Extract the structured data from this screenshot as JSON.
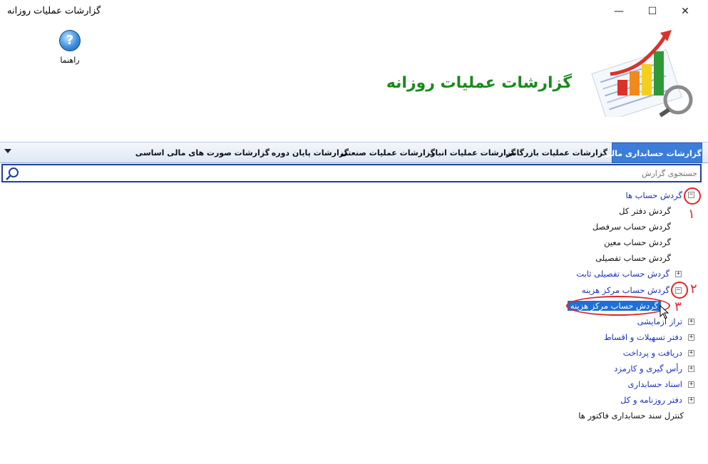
{
  "window": {
    "title": "گزارشات عملیات روزانه",
    "minimize_glyph": "—",
    "maximize_glyph": "☐",
    "close_glyph": "✕"
  },
  "toolbar": {
    "help_glyph": "?",
    "help_label": "راهنما"
  },
  "header": {
    "title": "گزارشات عملیات روزانه"
  },
  "tabs": [
    {
      "label": "گزارشات حسابداری مالی",
      "active": true
    },
    {
      "label": "گزارشات عملیات بازرگانی",
      "active": false
    },
    {
      "label": "گزارشات عملیات انبار",
      "active": false
    },
    {
      "label": "گزارشات عملیات صنعتی",
      "active": false
    },
    {
      "label": "گزارشات پایان دوره",
      "active": false
    },
    {
      "label": "گزارشات صورت های مالی اساسی",
      "active": false
    }
  ],
  "search": {
    "placeholder": "جستجوی گزارش"
  },
  "tree": {
    "items": [
      {
        "label": "گردش حساب ها",
        "type": "group",
        "state": "expanded"
      },
      {
        "label": "گردش دفتر کل",
        "type": "leaf"
      },
      {
        "label": "گردش حساب سرفصل",
        "type": "leaf"
      },
      {
        "label": "گردش حساب معین",
        "type": "leaf"
      },
      {
        "label": "گردش حساب تفصیلی",
        "type": "leaf"
      },
      {
        "label": "گردش حساب تفصیلی ثابت",
        "type": "group",
        "state": "collapsed"
      },
      {
        "label": "گردش حساب مرکز هزینه",
        "type": "group",
        "state": "expanded"
      },
      {
        "label": "گردش حساب مرکز هزینه",
        "type": "leaf",
        "selected": true
      },
      {
        "label": "تراز آزمایشی",
        "type": "group",
        "state": "collapsed"
      },
      {
        "label": "دفتر تسهیلات و اقساط",
        "type": "group",
        "state": "collapsed"
      },
      {
        "label": "دریافت و پرداخت",
        "type": "group",
        "state": "collapsed"
      },
      {
        "label": "رأس گیری و کارمزد",
        "type": "group",
        "state": "collapsed"
      },
      {
        "label": "اسناد حسابداری",
        "type": "group",
        "state": "collapsed"
      },
      {
        "label": "دفتر روزنامه و کل",
        "type": "group",
        "state": "collapsed"
      },
      {
        "label": "کنترل سند حسابداری فاکتور ها",
        "type": "leaf"
      }
    ]
  },
  "annotations": {
    "n1": "١",
    "n2": "٢",
    "n3": "٣",
    "color": "#e0262a"
  },
  "colors": {
    "accent": "#3b7dd8",
    "selection": "#1f6fd6",
    "banner_title": "#1a8a1a",
    "tree_group": "#1a2fbf"
  }
}
